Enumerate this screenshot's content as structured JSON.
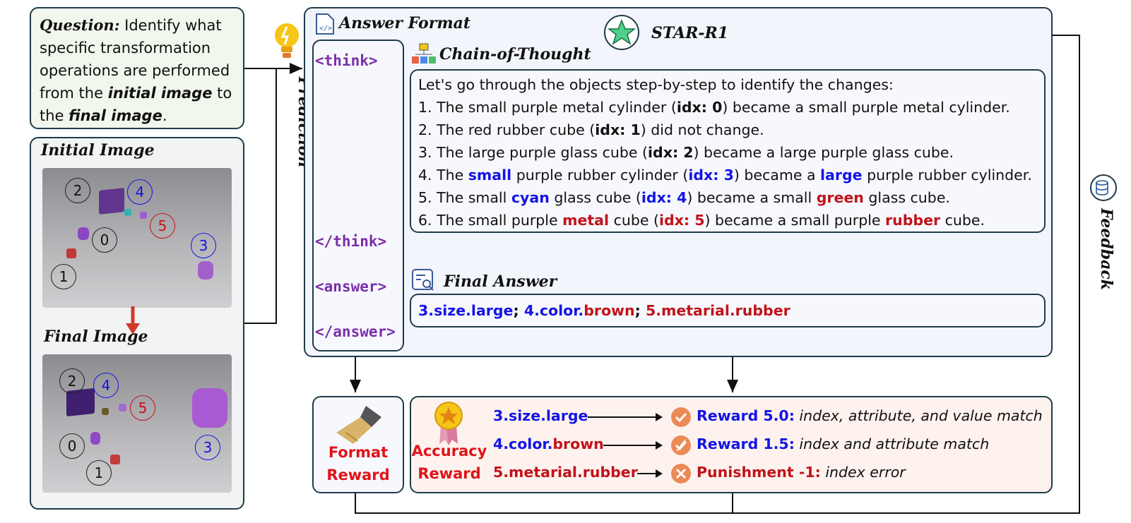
{
  "question": {
    "label": "Question:",
    "text1": " Identify what",
    "text2": "specific transformation",
    "text3": "operations are performed",
    "text4a": "from the ",
    "text4b": "initial image",
    "text4c": " to",
    "text5a": " the ",
    "text5b": "final image",
    "text5c": "."
  },
  "images": {
    "initial_title": "Initial Image",
    "final_title": "Final Image",
    "initial_labels": [
      "2",
      "4",
      "5",
      "0",
      "3",
      "1"
    ],
    "final_labels": [
      "2",
      "4",
      "5",
      "0",
      "3",
      "1"
    ]
  },
  "prediction_label": "Prediction",
  "feedback_label": "Feedback",
  "answer_format": {
    "title": "Answer Format",
    "model": "STAR-R1",
    "think_open": "<think>",
    "think_close": "</think>",
    "answer_open": "<answer>",
    "answer_close": "</answer>"
  },
  "cot": {
    "title": "Chain-of-Thought",
    "intro": "Let's go through the objects step-by-step to identify the changes:",
    "l1a": "1. The small purple metal cylinder (",
    "l1b": "idx: 0",
    "l1c": ") became a small purple metal cylinder.",
    "l2a": "2. The red rubber cube (",
    "l2b": "idx: 1",
    "l2c": ") did not change.",
    "l3a": "3. The large purple glass cube (",
    "l3b": "idx: 2",
    "l3c": ") became a large purple glass cube.",
    "l4a": "4. The ",
    "l4b": "small",
    "l4c": " purple rubber cylinder (",
    "l4d": "idx: 3",
    "l4e": ") became a ",
    "l4f": "large",
    "l4g": " purple rubber cylinder.",
    "l5a": "5. The small ",
    "l5b": "cyan",
    "l5c": " glass cube (",
    "l5d": "idx: 4",
    "l5e": ") became a small ",
    "l5f": "green",
    "l5g": " glass cube.",
    "l6a": "6. The small purple ",
    "l6b": "metal",
    "l6c": " cube (",
    "l6d": "idx: 5",
    "l6e": ") became a small purple ",
    "l6f": "rubber",
    "l6g": " cube."
  },
  "final_answer": {
    "title": "Final Answer",
    "p1a": "3.",
    "p1b": "size.large",
    "sep": "; ",
    "p2a": "4.color.",
    "p2b": "brown",
    "p3": "5.metarial.rubber"
  },
  "format_reward": {
    "line1": "Format",
    "line2": "Reward"
  },
  "accuracy_reward": {
    "line1": "Accuracy",
    "line2": "Reward",
    "rows": [
      {
        "pred_a": "3.size.large",
        "pred_b": "",
        "label": "Reward 5.0:",
        "desc": " index, attribute, and value match"
      },
      {
        "pred_a": "4.color.",
        "pred_b": "brown",
        "label": "Reward 1.5:",
        "desc": " index and attribute match"
      },
      {
        "pred_a": "",
        "pred_b": "5.metarial.rubber",
        "label": "Punishment -1:",
        "desc": " index error"
      }
    ]
  },
  "colors": {
    "border": "#1f3b4a",
    "question_bg": "#f1f7ec",
    "answer_bg": "#f2f5fb",
    "reward_bg": "#fdf2ee",
    "blue": "#1414e6",
    "red": "#c0131a",
    "purple": "#7a2fa8",
    "orange": "#ec8a55"
  }
}
